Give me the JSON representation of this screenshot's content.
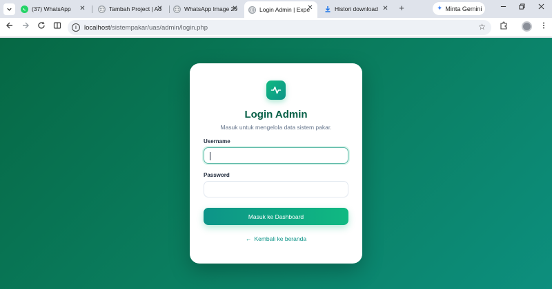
{
  "browser": {
    "tabs": [
      {
        "label": "(37) WhatsApp",
        "icon": "whatsapp-icon",
        "active": false
      },
      {
        "label": "Tambah Project | Ad",
        "icon": "globe-icon",
        "active": false
      },
      {
        "label": "WhatsApp Image 20",
        "icon": "globe-icon",
        "active": false
      },
      {
        "label": "Login Admin | Expe",
        "icon": "globe-icon",
        "active": true
      },
      {
        "label": "Histori download",
        "icon": "download-icon",
        "active": false
      }
    ],
    "gemini_label": "Minta Gemini",
    "url": {
      "host": "localhost",
      "path": "/sistempakar/uas/admin/login.php"
    }
  },
  "login": {
    "title": "Login Admin",
    "subtitle": "Masuk untuk mengelola data sistem pakar.",
    "username_label": "Username",
    "username_value": "",
    "password_label": "Password",
    "password_value": "",
    "submit_label": "Masuk ke Dashboard",
    "back_label": "Kembali ke beranda"
  },
  "colors": {
    "accent": "#10b981",
    "title": "#065f46",
    "link": "#0d9488",
    "background_start": "#066844",
    "background_end": "#0d8f7e"
  }
}
